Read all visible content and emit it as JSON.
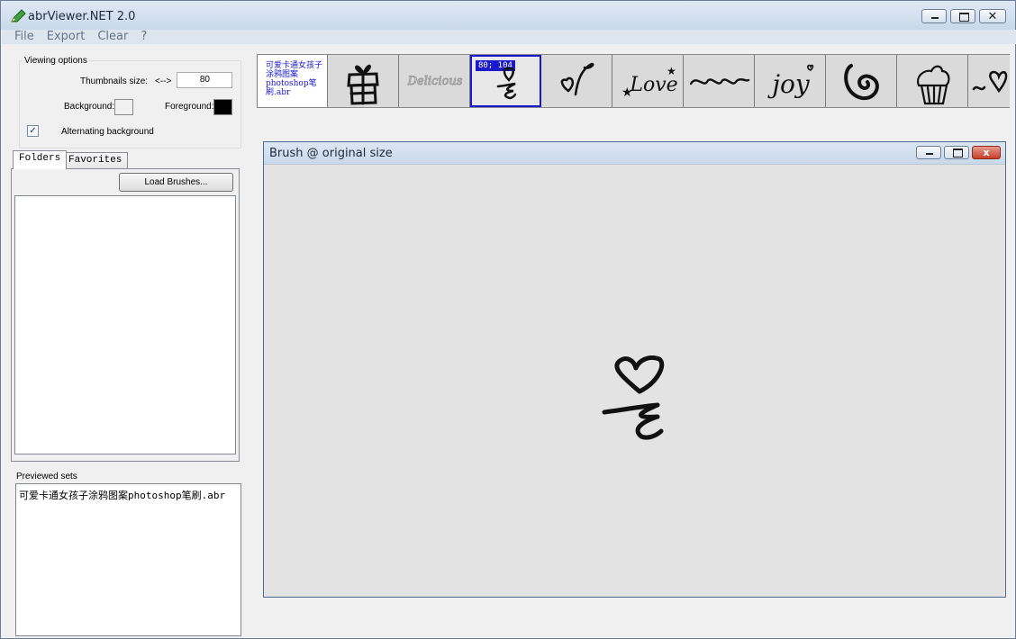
{
  "window": {
    "title": "abrViewer.NET 2.0",
    "buttons": {
      "minimize": "minimize",
      "maximize": "maximize",
      "close": "close"
    }
  },
  "menu": [
    "File",
    "Export",
    "Clear",
    "?"
  ],
  "viewing_options": {
    "group_title": "Viewing options",
    "thumb_size_label": "Thumbnails size:",
    "arrows": "<-->",
    "thumb_size_value": "80",
    "background_label": "Background:",
    "background_color": "#f0f0f0",
    "foreground_label": "Foreground:",
    "foreground_color": "#000000",
    "alternating_label": "Alternating background",
    "alternating_checked": true,
    "check_mark": "✓"
  },
  "tabs": [
    {
      "label": "Folders",
      "active": true
    },
    {
      "label": "Favorites",
      "active": false
    }
  ],
  "load_brushes_label": "Load Brushes...",
  "previewed_sets": {
    "label": "Previewed sets",
    "items": [
      "可爱卡通女孩子涂鸦图案photoshop笔刷.abr"
    ]
  },
  "thumbnails": {
    "first_text": "可爱卡通女孩子涂鸦图案photoshop笔刷.abr",
    "selected_dims": "80; 104",
    "items": [
      "set-title",
      "gift-box",
      "delicious-text",
      "heart-squiggle",
      "heart-swirl",
      "love-text",
      "loops",
      "joy-text",
      "spiral",
      "cupcake",
      "wave-heart"
    ]
  },
  "preview_window": {
    "title": "Brush @ original size",
    "close_glyph": "x"
  }
}
